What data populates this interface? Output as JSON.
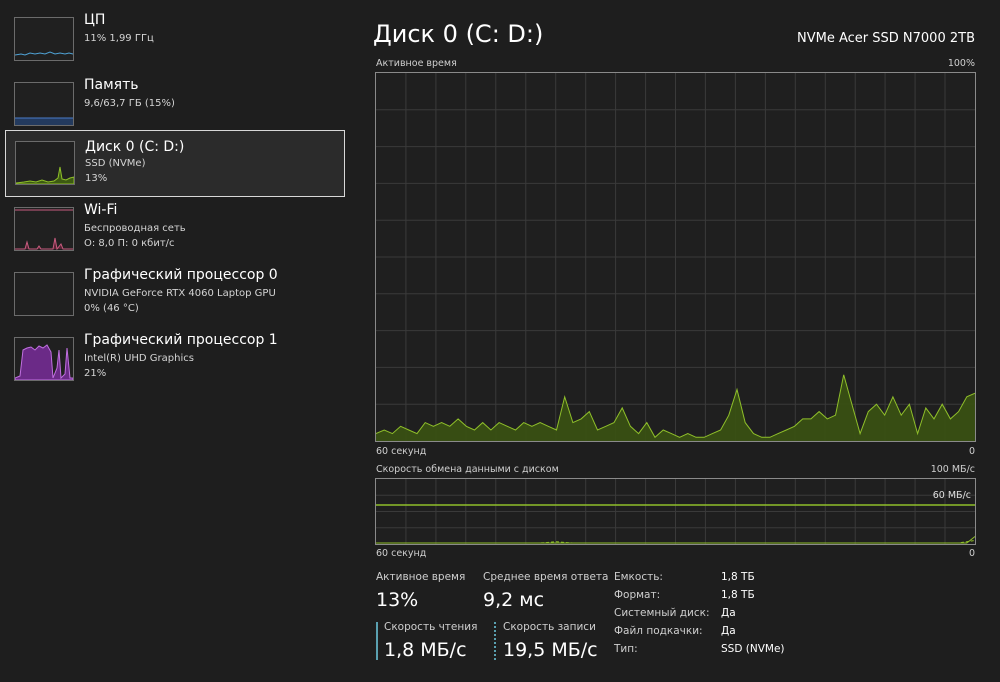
{
  "sidebar": {
    "items": [
      {
        "title": "ЦП",
        "line1": "11% 1,99 ГГц",
        "line2": "",
        "color": "#4fa3d6"
      },
      {
        "title": "Память",
        "line1": "9,6/63,7 ГБ (15%)",
        "line2": "",
        "color": "#4a7bc8"
      },
      {
        "title": "Диск 0 (C: D:)",
        "line1": "SSD (NVMe)",
        "line2": "13%",
        "color": "#8fbf2a"
      },
      {
        "title": "Wi-Fi",
        "line1": "Беспроводная сеть",
        "line2": "О: 8,0 П: 0 кбит/с",
        "color": "#c95b7f"
      },
      {
        "title": "Графический процессор 0",
        "line1": "NVIDIA GeForce RTX 4060 Laptop GPU",
        "line2": "0% (46 °C)",
        "color": "#a04fc0"
      },
      {
        "title": "Графический процессор 1",
        "line1": "Intel(R) UHD Graphics",
        "line2": "21%",
        "color": "#a04fc0"
      }
    ]
  },
  "header": {
    "title": "Диск 0 (C: D:)",
    "model": "NVMe Acer SSD N7000 2TB"
  },
  "active_chart": {
    "label": "Активное время",
    "max_label": "100%",
    "time_label": "60 секунд",
    "min_label": "0",
    "color": "#8fbf2a"
  },
  "transfer_chart": {
    "label": "Скорость обмена данными с диском",
    "max_label": "100 МБ/с",
    "ref_label": "60 МБ/с",
    "time_label": "60 секунд",
    "min_label": "0",
    "color": "#8fbf2a"
  },
  "stats": {
    "active_time_label": "Активное время",
    "active_time_value": "13%",
    "response_label": "Среднее время ответа",
    "response_value": "9,2 мс",
    "read_label": "Скорость чтения",
    "read_value": "1,8 МБ/с",
    "write_label": "Скорость записи",
    "write_value": "19,5 МБ/с"
  },
  "info": [
    {
      "label": "Емкость:",
      "value": "1,8 ТБ"
    },
    {
      "label": "Формат:",
      "value": "1,8 ТБ"
    },
    {
      "label": "Системный диск:",
      "value": "Да"
    },
    {
      "label": "Файл подкачки:",
      "value": "Да"
    },
    {
      "label": "Тип:",
      "value": "SSD (NVMe)"
    }
  ],
  "chart_data": [
    {
      "type": "area",
      "title": "Активное время",
      "xlabel": "60 секунд",
      "ylabel": "",
      "ylim": [
        0,
        100
      ],
      "xlim": [
        60,
        0
      ],
      "grid": true,
      "series": [
        {
          "values": [
            2,
            3,
            2,
            4,
            3,
            2,
            5,
            4,
            5,
            4,
            6,
            4,
            3,
            5,
            3,
            5,
            4,
            3,
            5,
            4,
            5,
            4,
            3,
            12,
            5,
            6,
            8,
            3,
            4,
            5,
            9,
            4,
            2,
            5,
            1,
            3,
            2,
            1,
            2,
            1,
            1,
            2,
            3,
            7,
            14,
            5,
            2,
            1,
            1,
            2,
            3,
            4,
            6,
            6,
            8,
            6,
            7,
            18,
            10,
            2,
            8,
            10,
            7,
            12,
            7,
            10,
            2,
            9,
            6,
            10,
            6,
            8,
            12,
            13
          ]
        }
      ]
    },
    {
      "type": "line",
      "title": "Скорость обмена данными с диском",
      "xlabel": "60 секунд",
      "ylabel": "",
      "ylim": [
        0,
        100
      ],
      "xlim": [
        60,
        0
      ],
      "grid": true,
      "series": [
        {
          "values": [
            0,
            0,
            0,
            0,
            0,
            0,
            0,
            0,
            0,
            0,
            0,
            0,
            0,
            0,
            0,
            0,
            0,
            0,
            0,
            0,
            0,
            0,
            0,
            0,
            0,
            0,
            0,
            0,
            0,
            0,
            0,
            0,
            0,
            0,
            0,
            0,
            0,
            0,
            0,
            0,
            0,
            0,
            0,
            0,
            0,
            0,
            0,
            0,
            0,
            0,
            0,
            0,
            0,
            0,
            0,
            0,
            0,
            0,
            0,
            0,
            0,
            0,
            0,
            0,
            0,
            0,
            0,
            0,
            0,
            0,
            0,
            0,
            0,
            10
          ]
        },
        {
          "values": [
            0,
            0,
            0,
            0,
            0,
            0,
            0,
            0,
            0,
            0,
            0,
            0,
            0,
            0,
            0,
            0,
            0,
            0,
            0,
            0,
            0,
            1,
            2,
            1,
            0,
            0,
            0,
            0,
            0,
            0,
            0,
            0,
            0,
            0,
            0,
            0,
            0,
            0,
            0,
            0,
            0,
            0,
            0,
            0,
            0,
            0,
            0,
            0,
            0,
            0,
            0,
            0,
            0,
            0,
            0,
            0,
            0,
            0,
            0,
            0,
            0,
            0,
            0,
            0,
            0,
            0,
            0,
            0,
            0,
            0,
            0,
            0,
            2,
            4
          ]
        }
      ],
      "reference_line": 60
    }
  ]
}
